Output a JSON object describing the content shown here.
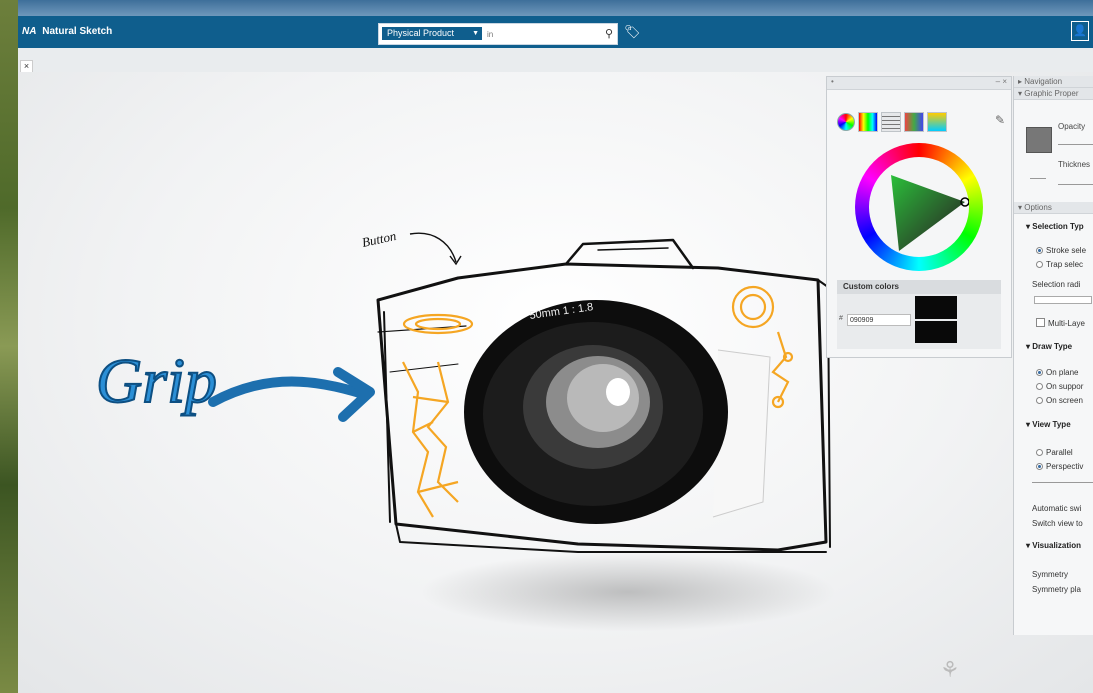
{
  "app": {
    "brand": "NA",
    "title": "Natural Sketch"
  },
  "search": {
    "category": "Physical Product",
    "placeholder": "in"
  },
  "icons": {
    "search": "search-icon",
    "tag": "tag-icon",
    "user": "user-icon",
    "close": "close-icon",
    "dropper": "eyedropper-icon",
    "compass": "compass-icon"
  },
  "sketch": {
    "grip_text": "Grip",
    "button_text": "Button",
    "lens_text": "50mm  1 : 1.8"
  },
  "palette": {
    "custom_colors_label": "Custom colors",
    "hex_value": "090909",
    "current_color": "#090909"
  },
  "panel": {
    "navigation": "Navigation",
    "graphic_properties": "Graphic Proper",
    "opacity": "Opacity",
    "thickness": "Thicknes",
    "options": "Options",
    "selection_type": "Selection Typ",
    "stroke_select": "Stroke sele",
    "trap_select": "Trap selec",
    "selection_radius": "Selection radi",
    "multi_layer": "Multi-Laye",
    "draw_type": "Draw Type",
    "on_plane": "On plane",
    "on_support": "On suppor",
    "on_screen": "On screen",
    "view_type": "View Type",
    "parallel": "Parallel",
    "perspective": "Perspectiv",
    "automatic_switch": "Automatic swi",
    "switch_view": "Switch view to",
    "visualization": "Visualization",
    "symmetry": "Symmetry",
    "symmetry_plane": "Symmetry pla"
  }
}
